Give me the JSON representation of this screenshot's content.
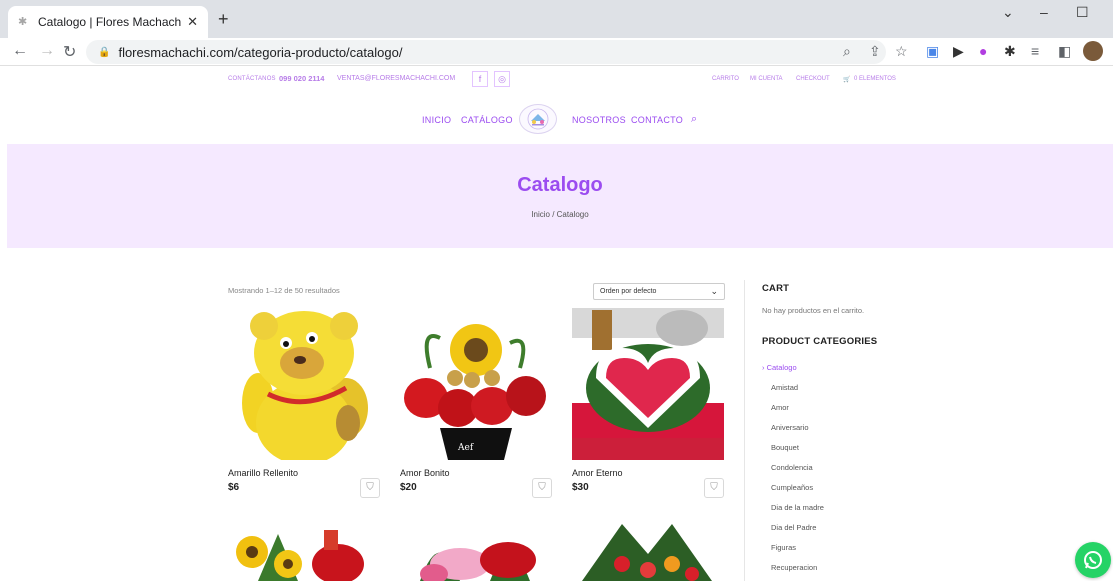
{
  "browser": {
    "tab_title": "Catalogo | Flores Machachi",
    "url": "floresmachachi.com/categoria-producto/catalogo/"
  },
  "topbar": {
    "contact_label": "CONTÁCTANOS",
    "phone": "099 020 2114",
    "email": "VENTAS@FLORESMACHACHI.COM",
    "cart_link": "CARRITO",
    "account_link": "MI CUENTA",
    "checkout_link": "CHECKOUT",
    "items_count": "0 ELEMENTOS"
  },
  "nav": {
    "inicio": "INICIO",
    "catalogo": "CATÁLOGO",
    "nosotros": "NOSOTROS",
    "contacto": "CONTACTO"
  },
  "hero": {
    "title": "Catalogo",
    "breadcrumb": "Inicio / Catalogo"
  },
  "shop": {
    "result_count": "Mostrando 1–12 de 50 resultados",
    "orderby": "Orden por defecto",
    "products": [
      {
        "name": "Amarillo Rellenito",
        "price": "$6"
      },
      {
        "name": "Amor Bonito",
        "price": "$20"
      },
      {
        "name": "Amor Eterno",
        "price": "$30"
      }
    ]
  },
  "sidebar": {
    "cart_heading": "CART",
    "cart_empty": "No hay productos en el carrito.",
    "categories_heading": "PRODUCT CATEGORIES",
    "categories": [
      "Catalogo",
      "Amistad",
      "Amor",
      "Aniversario",
      "Bouquet",
      "Condolencia",
      "Cumpleaños",
      "Dia de la madre",
      "Dia del Padre",
      "Figuras",
      "Recuperacion"
    ]
  },
  "colors": {
    "accent": "#9b4cf0",
    "hero_bg": "#f5e9ff",
    "whatsapp": "#25d366"
  }
}
